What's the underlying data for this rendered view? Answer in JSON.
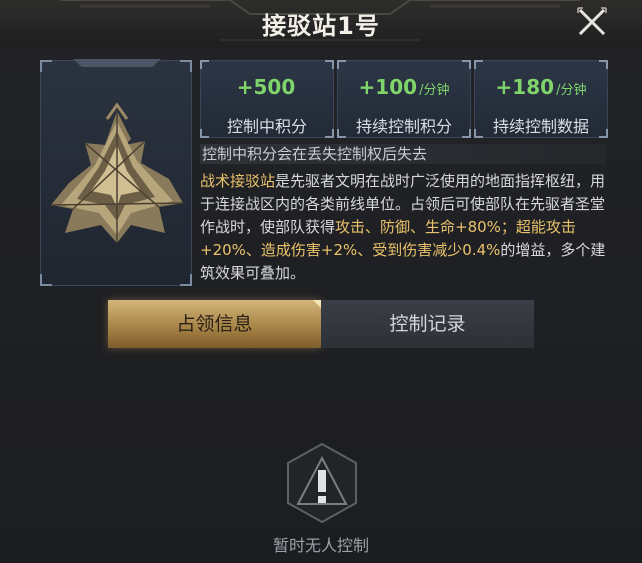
{
  "header": {
    "title": "接驳站1号"
  },
  "stats": [
    {
      "value": "+500",
      "unit": "",
      "label": "控制中积分"
    },
    {
      "value": "+100",
      "unit": "/分钟",
      "label": "持续控制积分"
    },
    {
      "value": "+180",
      "unit": "/分钟",
      "label": "持续控制数据"
    }
  ],
  "note": "控制中积分会在丢失控制权后失去",
  "description": {
    "p1": "战术接驳站",
    "p2": "是先驱者文明在战时广泛使用的地面指挥枢纽，用于连接战区内的各类前线单位。占领后可使部队在先驱者圣堂作战时，使部队获得",
    "p3": "攻击、防御、生命+80%；超能攻击+20%、造成伤害+2%、受到伤害减少0.4%",
    "p4": "的增益，多个建筑效果可叠加。"
  },
  "tabs": {
    "occupy": "占领信息",
    "records": "控制记录"
  },
  "empty": {
    "text": "暂时无人控制"
  },
  "colors": {
    "accent": "#d3b57b",
    "positive": "#7fd46a",
    "highlight": "#e9c26b"
  },
  "icons": {
    "close": "close-icon",
    "warning": "warning-icon"
  }
}
